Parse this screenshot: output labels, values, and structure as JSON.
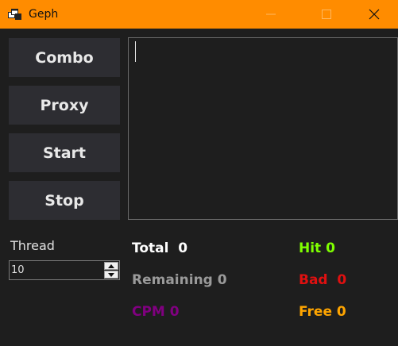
{
  "window": {
    "title": "Geph",
    "titlebar_color": "#ff8c00",
    "background_color": "#1e1e1e",
    "icons": {
      "app": "app-window-icon",
      "minimize": "minimize-icon",
      "maximize": "maximize-icon",
      "close": "close-icon"
    }
  },
  "buttons": {
    "combo": "Combo",
    "proxy": "Proxy",
    "start": "Start",
    "stop": "Stop"
  },
  "log": {
    "value": ""
  },
  "thread": {
    "label": "Thread",
    "value": "10"
  },
  "stats": {
    "total": "Total  0",
    "remaining": "Remaining 0",
    "cpm": "CPM 0",
    "hit": "Hit 0",
    "bad": "Bad  0",
    "free": "Free 0"
  },
  "colors": {
    "total": "#ffffff",
    "remaining": "#9a9a9a",
    "cpm": "#800080",
    "hit": "#7fff00",
    "bad": "#e01010",
    "free": "#ffa500"
  }
}
